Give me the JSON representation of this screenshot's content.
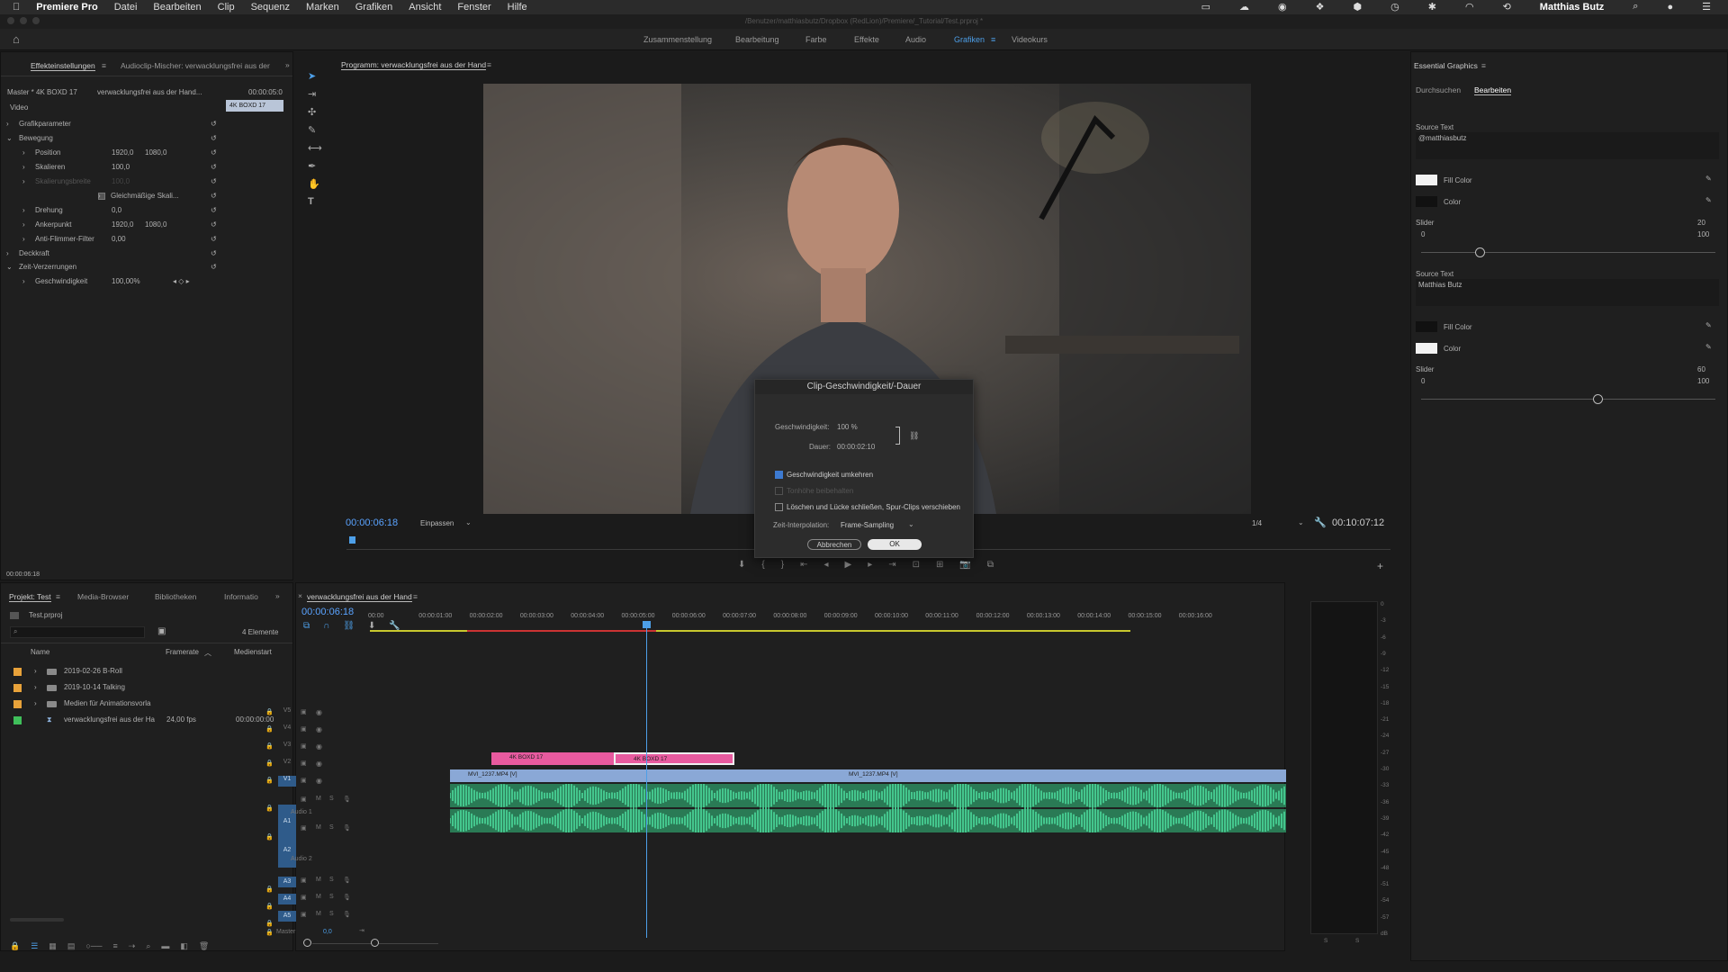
{
  "menubar": {
    "apple": "",
    "app": "Premiere Pro",
    "items": [
      "Datei",
      "Bearbeiten",
      "Clip",
      "Sequenz",
      "Marken",
      "Grafiken",
      "Ansicht",
      "Fenster",
      "Hilfe"
    ],
    "user": "Matthias Butz"
  },
  "titlebar": "/Benutzer/matthiasbutz/Dropbox (RedLion)/Premiere/_Tutorial/Test.prproj *",
  "workspaces": [
    "Zusammenstellung",
    "Bearbeitung",
    "Farbe",
    "Effekte",
    "Audio",
    "Grafiken",
    "Videokurs"
  ],
  "effects": {
    "tabs": [
      "Effekteinstellungen",
      "Audioclip-Mischer: verwacklungsfrei aus der"
    ],
    "master": "Master * 4K BOXD 17",
    "clip": "verwacklungsfrei aus der Hand...",
    "tc_right": "00:00:05:0",
    "clip_block": "4K BOXD 17",
    "video_label": "Video",
    "rows": [
      {
        "label": "Grafikparameter"
      },
      {
        "label": "Bewegung"
      },
      {
        "label": "Position",
        "v1": "1920,0",
        "v2": "1080,0"
      },
      {
        "label": "Skalieren",
        "v1": "100,0"
      },
      {
        "label": "Skalierungsbreite",
        "v1": "100,0"
      },
      {
        "label": "Gleichmäßige Skali..."
      },
      {
        "label": "Drehung",
        "v1": "0,0"
      },
      {
        "label": "Ankerpunkt",
        "v1": "1920,0",
        "v2": "1080,0"
      },
      {
        "label": "Anti-Flimmer-Filter",
        "v1": "0,00"
      },
      {
        "label": "Deckkraft"
      },
      {
        "label": "Zeit-Verzerrungen"
      },
      {
        "label": "Geschwindigkeit",
        "v1": "100,00%"
      }
    ],
    "bottom_tc": "00:00:06:18"
  },
  "program": {
    "title": "Programm: verwacklungsfrei aus der Hand",
    "tc": "00:00:06:18",
    "fit": "Einpassen",
    "quality": "1/4",
    "duration": "00:10:07:12"
  },
  "dialog": {
    "title": "Clip-Geschwindigkeit/-Dauer",
    "speed_label": "Geschwindigkeit:",
    "speed": "100 %",
    "duration_label": "Dauer:",
    "duration": "00:00:02:10",
    "cb1": "Geschwindigkeit umkehren",
    "cb2": "Tonhöhe beibehalten",
    "cb3": "Löschen und Lücke schließen, Spur-Clips verschieben",
    "interp_label": "Zeit-Interpolation:",
    "interp": "Frame-Sampling",
    "cancel": "Abbrechen",
    "ok": "OK"
  },
  "essential": {
    "title": "Essential Graphics",
    "tabs": [
      "Durchsuchen",
      "Bearbeiten"
    ],
    "groups": [
      {
        "source_label": "Source Text",
        "source": "@matthiasbutz",
        "fill": "Fill Color",
        "color": "Color",
        "slider": "Slider",
        "val": "20",
        "min": "0",
        "max": "100",
        "fill_hex": "#f2f2f2",
        "color_hex": "#111111",
        "fraction": 0.2
      },
      {
        "source_label": "Source Text",
        "source": "Matthias Butz",
        "fill": "Fill Color",
        "color": "Color",
        "slider": "Slider",
        "val": "60",
        "min": "0",
        "max": "100",
        "fill_hex": "#111111",
        "color_hex": "#f2f2f2",
        "fraction": 0.6
      }
    ]
  },
  "project": {
    "tabs": [
      "Projekt: Test",
      "Media-Browser",
      "Bibliotheken",
      "Informatio"
    ],
    "file": "Test.prproj",
    "count": "4 Elemente",
    "cols": [
      "Name",
      "Framerate",
      "Medienstart"
    ],
    "items": [
      {
        "name": "2019-02-26 B-Roll",
        "color": "#e8a23a",
        "folder": true,
        "fps": "",
        "start": ""
      },
      {
        "name": "2019-10-14 Talking",
        "color": "#e8a23a",
        "folder": true,
        "fps": "",
        "start": ""
      },
      {
        "name": "Medien für Animationsvorla",
        "color": "#e8a23a",
        "folder": true,
        "fps": "",
        "start": ""
      },
      {
        "name": "verwacklungsfrei aus der Ha",
        "color": "#3fbf5a",
        "folder": false,
        "fps": "24,00 fps",
        "start": "00:00:00:00"
      }
    ]
  },
  "timeline": {
    "tab": "verwacklungsfrei aus der Hand",
    "tc": "00:00:06:18",
    "ruler": [
      "00:00",
      "00:00:01:00",
      "00:00:02:00",
      "00:00:03:00",
      "00:00:04:00",
      "00:00:05:00",
      "00:00:06:00",
      "00:00:07:00",
      "00:00:08:00",
      "00:00:09:00",
      "00:00:10:00",
      "00:00:11:00",
      "00:00:12:00",
      "00:00:13:00",
      "00:00:14:00",
      "00:00:15:00",
      "00:00:16:00"
    ],
    "vtracks": [
      "V5",
      "V4",
      "V3",
      "V2",
      "V1"
    ],
    "atracks": [
      "A1",
      "A2",
      "A3",
      "A4",
      "A5"
    ],
    "audio1": "Audio 1",
    "audio2": "Audio 2",
    "master": "Master",
    "master_val": "0,0",
    "clips": {
      "pink1": "4K BOXD 17",
      "pink2": "4K BOXD 17",
      "blue1": "MVI_1237.MP4 [V]",
      "blue2": "MVI_1237.MP4 [V]"
    }
  },
  "meter": [
    "0",
    "-3",
    "-6",
    "-9",
    "-12",
    "-15",
    "-18",
    "-21",
    "-24",
    "-27",
    "-30",
    "-33",
    "-36",
    "-39",
    "-42",
    "-45",
    "-48",
    "-51",
    "-54",
    "-57",
    "dB"
  ],
  "meter_bottom": [
    "S",
    "S"
  ]
}
